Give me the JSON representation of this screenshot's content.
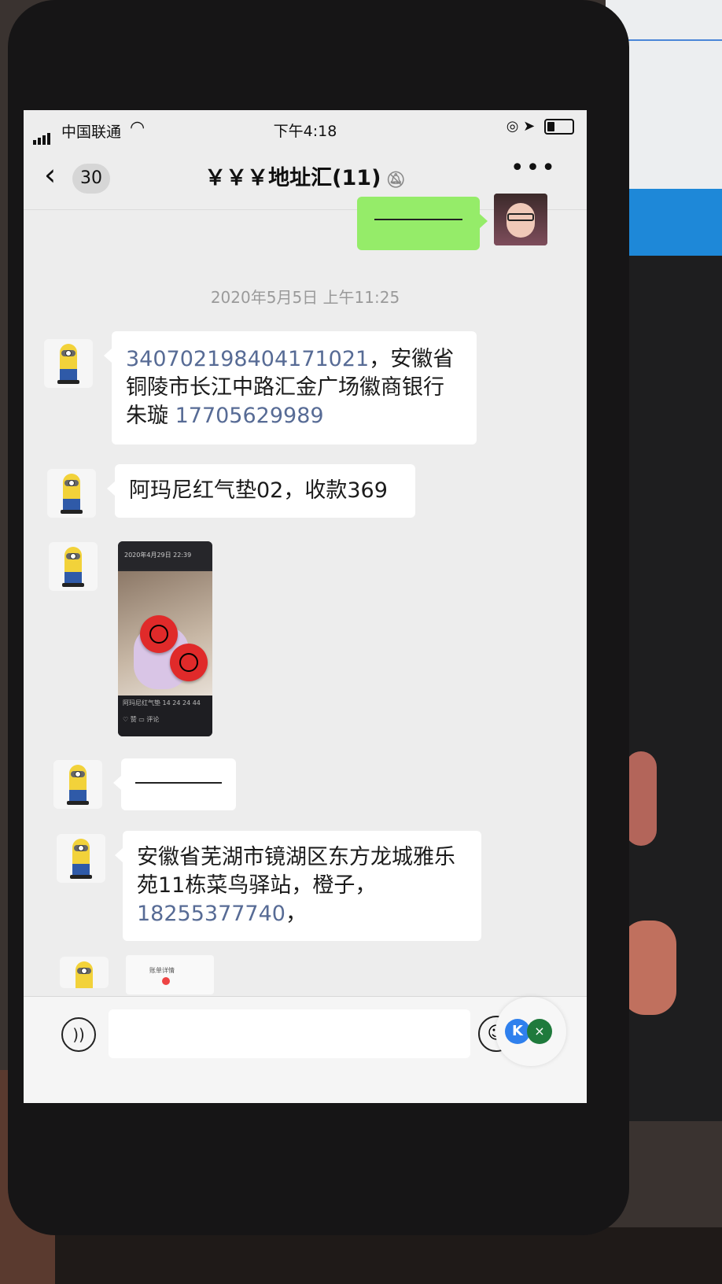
{
  "status_bar": {
    "carrier": "中国联通",
    "time": "下午4:18"
  },
  "nav": {
    "unread_count": "30",
    "title": "￥￥￥地址汇(11)"
  },
  "messages": {
    "timestamp": "2020年5月5日 上午11:25",
    "msg1_number": "340702198404171021",
    "msg1_text": "，安徽省铜陵市长江中路汇金广场徽商银行朱璇 ",
    "msg1_phone": "17705629989",
    "msg2_text": "阿玛尼红气垫02，收款369",
    "img1_header": "2020年4月29日 22:39",
    "img1_caption": "阿玛尼红气垫 14 24 24 44",
    "img1_actions": "♡ 赞   ▭ 评论",
    "msg5_text": "安徽省芜湖市镜湖区东方龙城雅乐苑11栋菜鸟驿站，橙子，",
    "msg5_phone": "18255377740",
    "msg5_suffix": "，",
    "img2_title": "账单详情"
  },
  "icons": {
    "wifi": "wifi-icon",
    "back": "back-arrow-icon",
    "mute": "mute-bell-icon",
    "more": "more-icon",
    "voice": "voice-icon",
    "emoji": "emoji-icon"
  },
  "colors": {
    "outgoing_bubble": "#95ec69",
    "link": "#576b95"
  }
}
